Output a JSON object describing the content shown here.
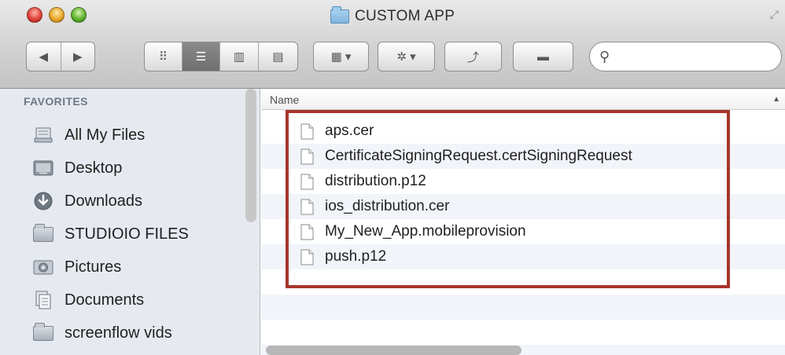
{
  "window": {
    "title": "CUSTOM APP"
  },
  "toolbar": {
    "back_glyph": "◀",
    "forward_glyph": "▶",
    "view_icon_glyph": "⠿",
    "view_list_glyph": "☰",
    "view_column_glyph": "▥",
    "view_coverflow_glyph": "▤",
    "arrange_glyph": "▦ ▾",
    "action_glyph": "✲ ▾",
    "share_glyph": "⤴",
    "tag_glyph": "▬",
    "search_icon_glyph": "⚲",
    "search_placeholder": ""
  },
  "sidebar": {
    "heading": "FAVORITES",
    "items": [
      {
        "label": "All My Files",
        "icon": "all-files-icon"
      },
      {
        "label": "Desktop",
        "icon": "desktop-icon"
      },
      {
        "label": "Downloads",
        "icon": "downloads-icon"
      },
      {
        "label": "STUDIOIO FILES",
        "icon": "folder-icon"
      },
      {
        "label": "Pictures",
        "icon": "pictures-icon"
      },
      {
        "label": "Documents",
        "icon": "documents-icon"
      },
      {
        "label": "screenflow vids",
        "icon": "folder-icon"
      }
    ]
  },
  "content": {
    "column_header": "Name",
    "sort_glyph": "▲",
    "files": [
      "aps.cer",
      "CertificateSigningRequest.certSigningRequest",
      "distribution.p12",
      "ios_distribution.cer",
      "My_New_App.mobileprovision",
      "push.p12"
    ]
  },
  "colors": {
    "highlight_border": "#a8352c",
    "sidebar_bg": "#e6eaf0",
    "row_alt": "#f1f4f9"
  }
}
